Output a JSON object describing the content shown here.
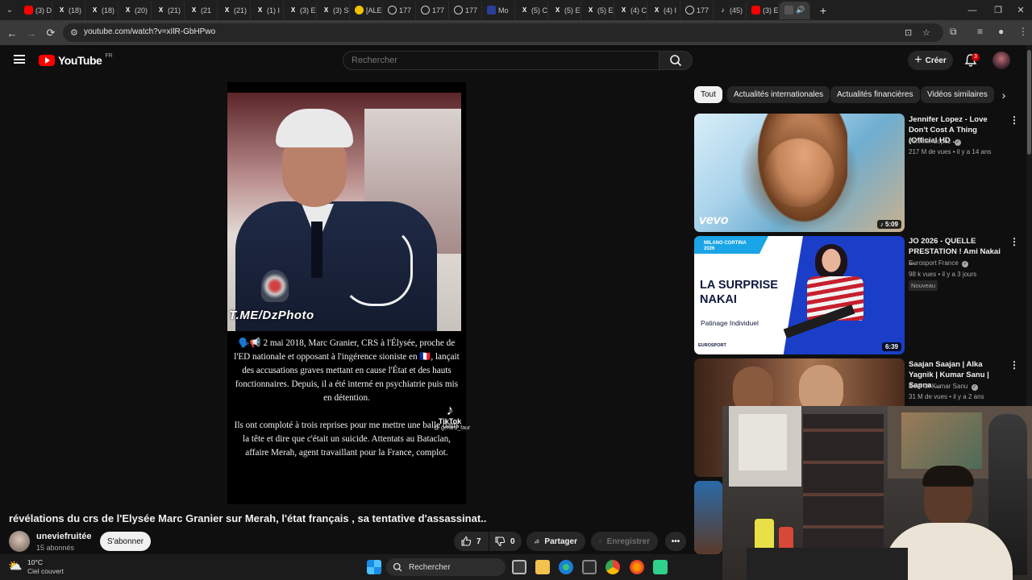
{
  "browser": {
    "tabs": [
      {
        "label": "(3) D",
        "icon": "youtube-icon",
        "color": "#ff0000"
      },
      {
        "label": "(18)",
        "icon": "x-icon",
        "color": "#ffffff"
      },
      {
        "label": "(18)",
        "icon": "x-icon",
        "color": "#ffffff"
      },
      {
        "label": "(20)",
        "icon": "x-icon",
        "color": "#ffffff"
      },
      {
        "label": "(21)",
        "icon": "x-icon",
        "color": "#ffffff"
      },
      {
        "label": "(21",
        "icon": "x-icon",
        "color": "#ffffff"
      },
      {
        "label": "(21)",
        "icon": "x-icon",
        "color": "#ffffff"
      },
      {
        "label": "(1) I",
        "icon": "x-icon",
        "color": "#ffffff"
      },
      {
        "label": "(3) E",
        "icon": "x-icon",
        "color": "#ffffff"
      },
      {
        "label": "(3) S",
        "icon": "x-icon",
        "color": "#ffffff"
      },
      {
        "label": "[ALE",
        "icon": "emoji-icon",
        "color": "#f2c200"
      },
      {
        "label": "177",
        "icon": "globe-icon",
        "color": "#cccccc"
      },
      {
        "label": "177",
        "icon": "globe-icon",
        "color": "#cccccc"
      },
      {
        "label": "177",
        "icon": "globe-icon",
        "color": "#cccccc"
      },
      {
        "label": "Mo",
        "icon": "site-icon",
        "color": "#2a3f9a"
      },
      {
        "label": "(5) C",
        "icon": "x-icon",
        "color": "#ffffff"
      },
      {
        "label": "(5) E",
        "icon": "x-icon",
        "color": "#ffffff"
      },
      {
        "label": "(5) E",
        "icon": "x-icon",
        "color": "#ffffff"
      },
      {
        "label": "(4) C",
        "icon": "x-icon",
        "color": "#ffffff"
      },
      {
        "label": "(4) I",
        "icon": "x-icon",
        "color": "#ffffff"
      },
      {
        "label": "177",
        "icon": "globe-icon",
        "color": "#cccccc"
      },
      {
        "label": "(45)",
        "icon": "tiktok-icon",
        "color": "#ffffff"
      },
      {
        "label": "(3) E",
        "icon": "youtube-icon",
        "color": "#ff0000"
      }
    ],
    "active_tab_label": "(",
    "new_tab": "+",
    "url": "youtube.com/watch?v=xIlR-GbHPwo"
  },
  "youtube": {
    "logo_text": "YouTube",
    "country_code": "FR",
    "search_placeholder": "Rechercher",
    "create_label": "Créer",
    "notification_count": "3"
  },
  "video": {
    "watermark": "T.ME/DzPhoto",
    "text_paragraph_1": "🗣️📢 2 mai 2018, Marc Granier, CRS à l'Élysée, proche de l'ED nationale et opposant à l'ingérence sioniste en 🇫🇷, lançait des accusations graves mettant en cause l'État et des hauts fonctionnaires. Depuis, il a été interné en psychiatrie puis mis en détention.",
    "text_paragraph_2": "Ils ont comploté à trois reprises pour me mettre une balle dans la tête et dire que c'était un suicide. Attentats au Bataclan, affaire Merah, agent travaillant pour la France, complot.",
    "tiktok_label": "TikTok",
    "tiktok_user": "@ gerard_faur",
    "title": "révélations du crs de l'Elysée Marc Granier sur Merah, l'état français , sa tentative d'assassinat..",
    "channel_name": "uneviefruitée",
    "channel_subs": "15 abonnés",
    "subscribe_label": "S'abonner",
    "likes": "7",
    "dislikes": "0",
    "share_label": "Partager",
    "save_label": "Enregistrer",
    "more_label": "•••"
  },
  "chips": [
    "Tout",
    "Actualités internationales",
    "Actualités financières",
    "Vidéos similaires"
  ],
  "recommendations": [
    {
      "title": "Jennifer Lopez - Love Don't Cost A Thing (Official HD ...",
      "channel": "Jennifer Lopez",
      "meta": "217 M de vues • il y a 14 ans",
      "duration": "♪ 5:09",
      "thumb_logo": "vevo"
    },
    {
      "title": "JO 2026 - QUELLE PRESTATION ! Ami Nakai ...",
      "channel": "Eurosport France",
      "meta": "98 k vues • il y a 3 jours",
      "badge": "Nouveau",
      "duration": "6:39",
      "thumb_header": "MILANO CORTINA 2026",
      "thumb_headline": "LA SURPRISE NAKAI",
      "thumb_sub": "Patinage Individuel",
      "thumb_footer": "EUROSPORT"
    },
    {
      "title": "Saajan Saajan | Alka Yagnik | Kumar Sanu | Sapna ...",
      "channel": "Best Of Kumar Sanu",
      "meta": "31 M de vues • il y a 2 ans"
    }
  ],
  "taskbar": {
    "weather_temp": "10°C",
    "weather_desc": "Ciel couvert",
    "search_label": "Rechercher"
  },
  "colors": {
    "background": "#0f0f0f",
    "accent_red": "#ff0000",
    "pill": "#272727"
  }
}
